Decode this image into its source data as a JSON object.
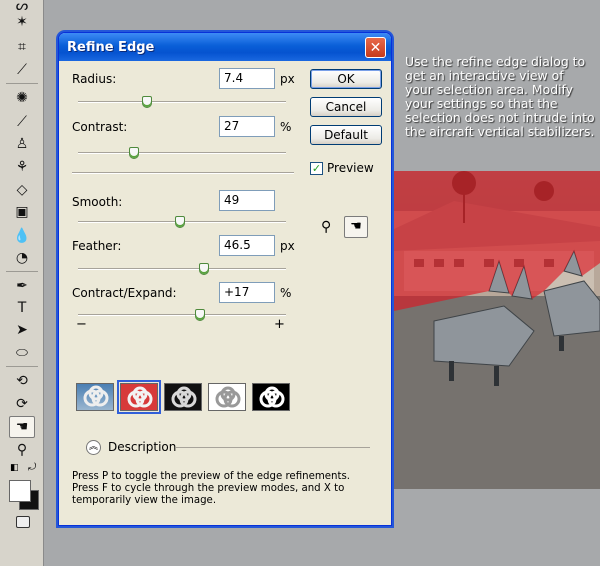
{
  "dialog": {
    "title": "Refine Edge",
    "close_glyph": "✕",
    "radius": {
      "label": "Radius:",
      "value": "7.4",
      "unit": "px",
      "slider_fraction": 0.33
    },
    "contrast": {
      "label": "Contrast:",
      "value": "27",
      "unit": "%",
      "slider_fraction": 0.27
    },
    "smooth": {
      "label": "Smooth:",
      "value": "49",
      "unit": "",
      "slider_fraction": 0.49
    },
    "feather": {
      "label": "Feather:",
      "value": "46.5",
      "unit": "px",
      "slider_fraction": 0.605
    },
    "contract_expand": {
      "label": "Contract/Expand:",
      "value": "+17",
      "unit": "%",
      "slider_fraction": 0.585,
      "minus": "−",
      "plus": "+"
    },
    "buttons": {
      "ok": "OK",
      "cancel": "Cancel",
      "default": "Default"
    },
    "preview": {
      "label": "Preview",
      "checked": true,
      "check_glyph": "✓"
    },
    "tools": {
      "zoom_icon": "magnifier-icon",
      "hand_icon": "hand-icon"
    },
    "preview_modes": [
      {
        "name": "standard",
        "selected": false
      },
      {
        "name": "quick-mask",
        "selected": true
      },
      {
        "name": "on-black",
        "selected": false
      },
      {
        "name": "on-white",
        "selected": false
      },
      {
        "name": "mask",
        "selected": false
      }
    ],
    "description": {
      "label": "Description",
      "text": "Press P to toggle the preview of the edge refinements. Press F to cycle through the preview modes, and X to temporarily view the image."
    }
  },
  "caption": "Use the refine edge dialog to get an interactive view of your selection area. Modify your settings so that the selection does not intrude into the aircraft vertical stabilizers.",
  "colors": {
    "dialog_bg": "#ece9d8",
    "title_blue": "#0553d0",
    "mask_red": "#e0141e",
    "workspace": "#a7a9ab"
  }
}
